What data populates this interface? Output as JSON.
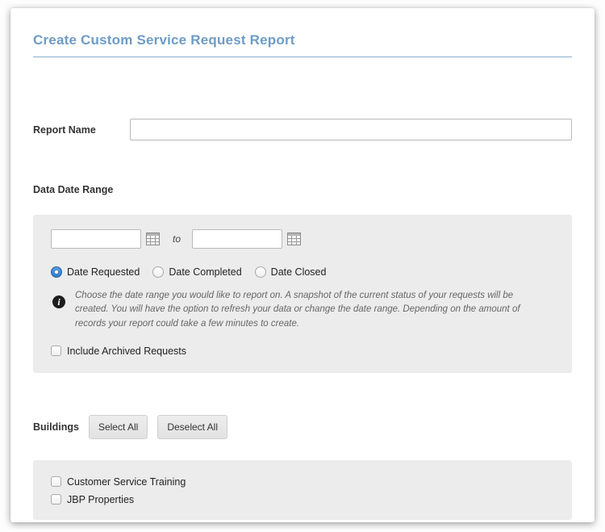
{
  "page": {
    "title": "Create Custom Service Request Report"
  },
  "colors": {
    "title_blue": "#6d9cc7",
    "divider_blue": "#8badcd",
    "panel_gray": "#ececec",
    "radio_selected_blue": "#2f7ac9",
    "info_icon_black": "#1c1c1c"
  },
  "icons": {
    "info": "i"
  },
  "report_name": {
    "label": "Report Name",
    "value": "",
    "placeholder": ""
  },
  "date_range": {
    "section_label": "Data Date Range",
    "from_value": "",
    "to_label": "to",
    "to_value": "",
    "radios": [
      {
        "label": "Date Requested",
        "selected": true
      },
      {
        "label": "Date Completed",
        "selected": false
      },
      {
        "label": "Date Closed",
        "selected": false
      }
    ],
    "info_text": "Choose the date range you would like to report on. A snapshot of the current status of your requests will be created. You will have the option to refresh your data or change the date range. Depending on the amount of records your report could take a few minutes to create.",
    "archived_checkbox": {
      "label": "Include Archived Requests",
      "checked": false
    }
  },
  "buildings": {
    "section_label": "Buildings",
    "select_all_label": "Select All",
    "deselect_all_label": "Deselect All",
    "items": [
      {
        "label": "Customer Service Training",
        "checked": false
      },
      {
        "label": "JBP Properties",
        "checked": false
      }
    ]
  }
}
